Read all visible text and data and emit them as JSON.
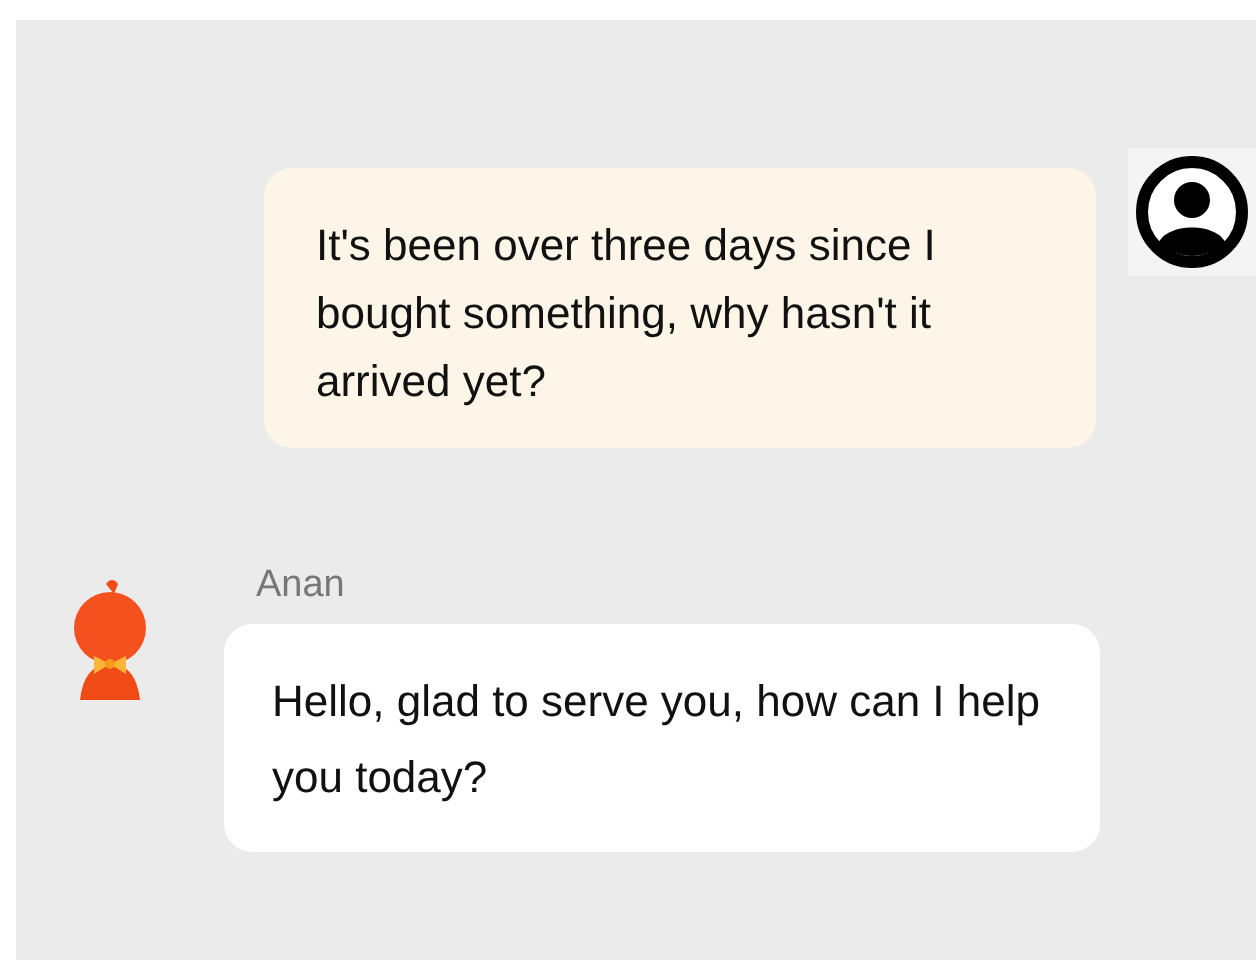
{
  "messages": [
    {
      "kind": "user",
      "text": "It's been over three days since I bought something, why hasn't it arrived yet?"
    },
    {
      "kind": "bot",
      "sender": "Anan",
      "text": "Hello, glad to serve you, how can I help you today?"
    }
  ]
}
